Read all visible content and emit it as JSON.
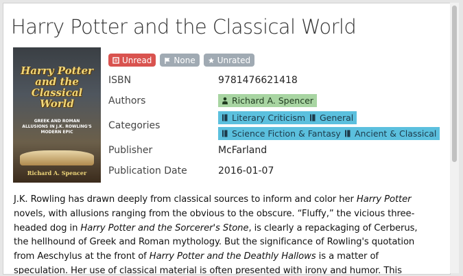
{
  "book": {
    "title": "Harry Potter and the Classical World",
    "cover": {
      "title": "Harry Potter and the Classical World",
      "subtitle": "Greek and Roman Allusions in J.K. Rowling's Modern Epic",
      "author": "Richard A. Spencer"
    },
    "badges": {
      "read_status": "Unread",
      "shelf": "None",
      "rating": "Unrated"
    },
    "fields": {
      "isbn_label": "ISBN",
      "isbn": "9781476621418",
      "authors_label": "Authors",
      "authors": [
        "Richard A. Spencer"
      ],
      "categories_label": "Categories",
      "categories": [
        "Literary Criticism",
        "General",
        "Science Fiction & Fantasy",
        "Ancient & Classical"
      ],
      "publisher_label": "Publisher",
      "publisher": "McFarland",
      "publication_date_label": "Publication Date",
      "publication_date": "2016-01-07"
    },
    "description": {
      "s1": "J.K. Rowling has drawn deeply from classical sources to inform and color her ",
      "s2": "Harry Potter",
      "s3": " novels, with allusions ranging from the obvious to the obscure. “Fluffy,” the vicious three-headed dog in ",
      "s4": "Harry Potter and the Sorcerer's Stone",
      "s5": ", is clearly a repackaging of Cerberus, the hellhound of Greek and Roman mythology. But the significance of Rowling's quotation from Aeschylus at the front of ",
      "s6": "Harry Potter and the Deathly Hallows",
      "s7": " is a matter of speculation. Her use of classical material is often presented with irony and humor. This"
    }
  },
  "colors": {
    "unread": "#d9534f",
    "neutral": "#a0aab3",
    "author_tag": "#a8d5a2",
    "category_tag": "#5bc0de"
  },
  "icons": {
    "unread": "book-icon",
    "shelf": "flag-icon",
    "rating": "star-icon",
    "author": "user-icon",
    "category": "bookmark-icon"
  }
}
